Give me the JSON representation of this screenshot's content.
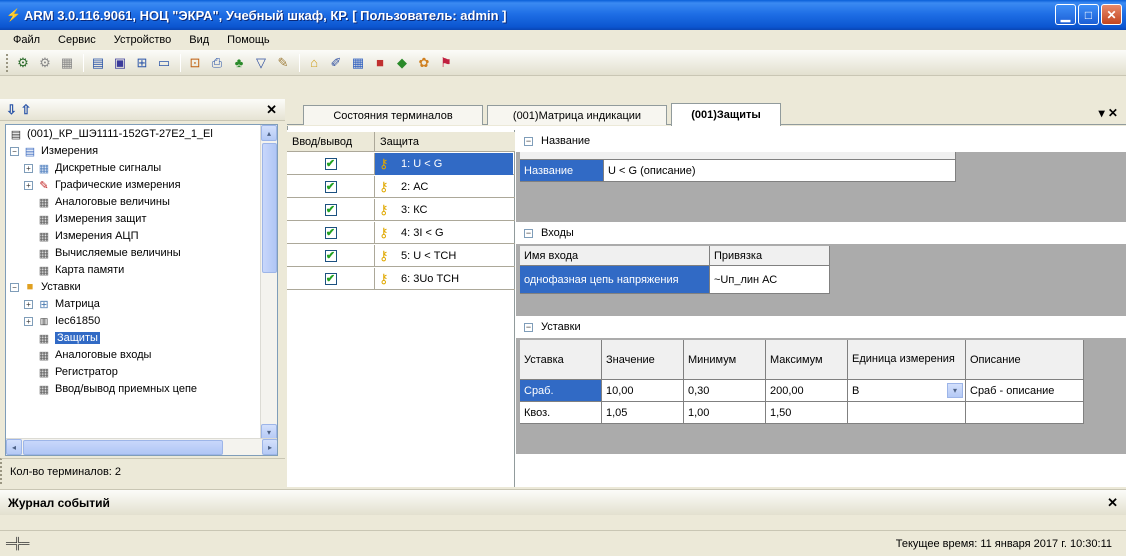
{
  "window": {
    "title": "ARM 3.0.116.9061, НОЦ \"ЭКРА\", Учебный шкаф, КР. [ Пользователь: admin ]",
    "colors": {
      "titlebar": "#1f6fe6",
      "selection": "#316ac5",
      "check": "#21a121",
      "key": "#e0a800"
    }
  },
  "menu": [
    "Файл",
    "Сервис",
    "Устройство",
    "Вид",
    "Помощь"
  ],
  "toolbar": {
    "icons": [
      "users-icon",
      "group-icon",
      "grid-icon",
      "list-icon",
      "chip-icon",
      "matrix-icon",
      "window-icon",
      "device-icon",
      "export-icon",
      "tree-icon",
      "filter-icon",
      "tools-icon",
      "folder-icon",
      "edit-icon",
      "settings-icon",
      "record-icon",
      "chart-icon",
      "plugin-icon",
      "flag-icon"
    ]
  },
  "tree": {
    "items": [
      {
        "label": "(001)_КР_ШЭ1111-152GT-27Е2_1_Еl",
        "icon": "device-icon"
      },
      {
        "label": "Измерения",
        "icon": "folder-icon"
      },
      {
        "label": "Дискретные сигналы",
        "icon": "table-icon"
      },
      {
        "label": "Графические измерения",
        "icon": "chart-icon"
      },
      {
        "label": "Аналоговые величины",
        "icon": "table-icon"
      },
      {
        "label": "Измерения защит",
        "icon": "table-icon"
      },
      {
        "label": "Измерения АЦП",
        "icon": "table-icon"
      },
      {
        "label": "Вычисляемые величины",
        "icon": "table-icon"
      },
      {
        "label": "Карта памяти",
        "icon": "table-icon"
      },
      {
        "label": "Уставки",
        "icon": "folder-icon"
      },
      {
        "label": "Матрица",
        "icon": "matrix-icon"
      },
      {
        "label": "Iec61850",
        "icon": "iec-icon"
      },
      {
        "label": "Защиты",
        "icon": "table-icon"
      },
      {
        "label": "Аналоговые входы",
        "icon": "table-icon"
      },
      {
        "label": "Регистратор",
        "icon": "table-icon"
      },
      {
        "label": "Ввод/вывод приемных цепе",
        "icon": "table-icon"
      }
    ],
    "selected": "Защиты"
  },
  "left_status": "Кол-во терминалов: 2",
  "tabs": [
    {
      "label": "Состояния терминалов"
    },
    {
      "label": "(001)Матрица индикации"
    },
    {
      "label": "(001)Защиты",
      "active": true
    }
  ],
  "protections": {
    "headers": [
      "Ввод/вывод",
      "Защита"
    ],
    "rows": [
      {
        "checked": "✔",
        "name": "1: U < G"
      },
      {
        "checked": "✔",
        "name": "2: АС"
      },
      {
        "checked": "✔",
        "name": "3: КС"
      },
      {
        "checked": "✔",
        "name": "4: 3I < G"
      },
      {
        "checked": "✔",
        "name": "5: U < ТСН"
      },
      {
        "checked": "✔",
        "name": "6: 3Uo ТСН"
      }
    ]
  },
  "sections": {
    "name": {
      "title": "Название",
      "row_label": "Название",
      "value": "U < G (описание)"
    },
    "inputs": {
      "title": "Входы",
      "headers": [
        "Имя входа",
        "Привязка"
      ],
      "row": [
        "однофазная цепь напряжения",
        "~Uп_лин АС"
      ]
    },
    "settings": {
      "title": "Уставки",
      "headers": [
        "Уставка",
        "Значение",
        "Минимум",
        "Максимум",
        "Единица измерения",
        "Описание"
      ],
      "rows": [
        [
          "Сраб.",
          "10,00",
          "0,30",
          "200,00",
          "В",
          "Сраб - описание"
        ],
        [
          "Квоз.",
          "1,05",
          "1,00",
          "1,50",
          "",
          ""
        ]
      ]
    }
  },
  "journal": "Журнал событий",
  "statusbar": {
    "time": "Текущее время: 11 января 2017 г. 10:30:11"
  },
  "glyphs": {
    "minimize": "▁",
    "maximize": "□",
    "close": "✕",
    "expand_plus": "+",
    "expand_minus": "−",
    "down": "▾",
    "left": "◂",
    "right": "▸",
    "up": "▴",
    "pin": "▾ ✕",
    "plug": "═╬═",
    "arrows": "⇩ ⇧"
  }
}
